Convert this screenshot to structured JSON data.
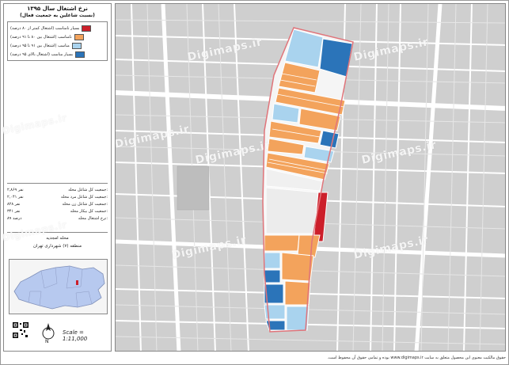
{
  "panel": {
    "title": "نرخ اشتغال سال ۱۳۹۵",
    "subtitle": "(نسبت شاغلین به جمعیت فعال)",
    "legend": [
      {
        "label": "بسیار نامناسب (اشتغال کمتر از ۸۰ درصد)",
        "color": "#cc1f2a"
      },
      {
        "label": "نامناسب (اشتغال بین ۸۰ تا ۹۱ درصد)",
        "color": "#f3a35c"
      },
      {
        "label": "مناسب (اشتغال بین ۹۱ تا ۹۵ درصد)",
        "color": "#a9d3ee"
      },
      {
        "label": "بسیار مناسب (اشتغال بالای ۹۵ درصد)",
        "color": "#2b74b9"
      }
    ],
    "stats": [
      {
        "label": "جمعیت کل شاغل محله:",
        "value": "۲,۸۶۹ نفر"
      },
      {
        "label": "جمعیت کل شاغل مرد محله:",
        "value": "۲,۰۴۱ نفر"
      },
      {
        "label": "جمعیت کل شاغل زن محله:",
        "value": "۸۲۸ نفر"
      },
      {
        "label": "جمعیت کل بیکار محله:",
        "value": "۳۴۱ نفر"
      },
      {
        "label": "نرخ اشتغال محله:",
        "value": "۸۹ درصد"
      }
    ],
    "neighborhood": "محله امجدیه",
    "district": "منطقه (۷) شهرداری تهران",
    "scale": "Scale = 1:11,000",
    "north_label": "N"
  },
  "map": {
    "watermark": "Digimaps.ir",
    "credits": "حقوق مالکیت معنوی این محصول متعلق به سایت www.digimaps.ir بوده و تمامی حقوق آن محفوظ است."
  },
  "colors": {
    "very_poor": "#cc1f2a",
    "poor": "#f3a35c",
    "good": "#a9d3ee",
    "very_good": "#2b74b9",
    "boundary": "#e0747a",
    "road": "#ffffff",
    "block": "#cfcfcf",
    "inset_city": "#b7c9ef",
    "inset_region": "#e0e6f7"
  }
}
